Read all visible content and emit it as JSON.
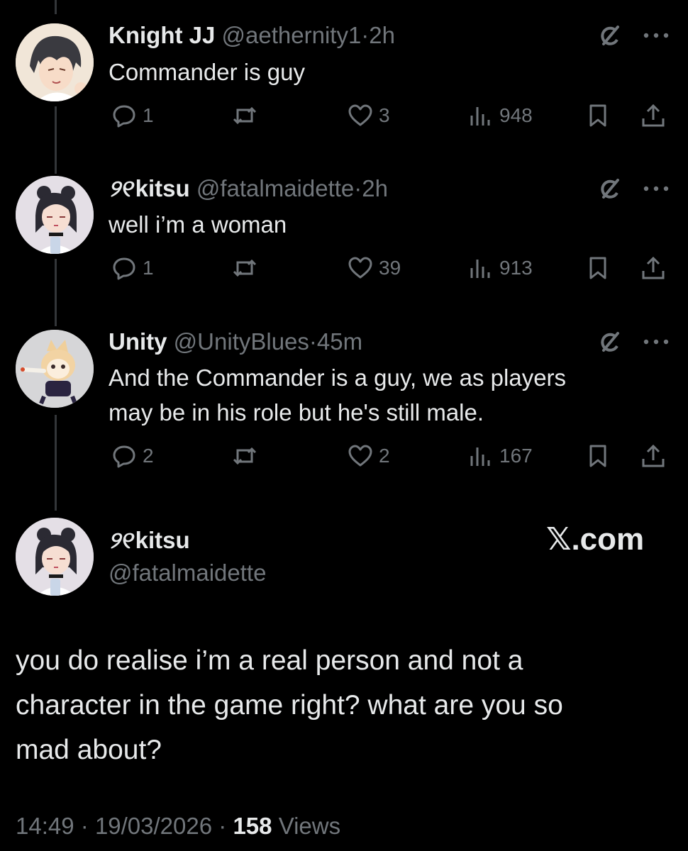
{
  "tweets": [
    {
      "name": "Knight JJ",
      "flower": "",
      "handle": "@aethernity1",
      "time": "2h",
      "text": "Commander is guy",
      "replies": "1",
      "likes": "3",
      "views": "948"
    },
    {
      "name": "kitsu",
      "flower": "୨୧",
      "handle": "@fatalmaidette",
      "time": "2h",
      "text": "well i’m a woman",
      "replies": "1",
      "likes": "39",
      "views": "913"
    },
    {
      "name": "Unity",
      "flower": "",
      "handle": "@UnityBlues",
      "time": "45m",
      "text_line1": "And the Commander is a guy, we as players",
      "text_line2": "may be in his role but he's still male.",
      "replies": "2",
      "likes": "2",
      "views": "167"
    }
  ],
  "main": {
    "flower": "୨୧",
    "name": "kitsu",
    "handle": "@fatalmaidette",
    "brand": "𝕏.com",
    "line1": "you do realise i’m a real person and not a",
    "line2": "character in the game right? what are you so",
    "line3": "mad about?",
    "time": "14:49",
    "date": "19/03/2026",
    "views_count": "158",
    "views_label": "Views"
  },
  "separator": "·",
  "icons": [
    "reply-icon",
    "retweet-icon",
    "like-icon",
    "views-icon",
    "bookmark-icon",
    "share-icon",
    "grok-icon",
    "more-icon"
  ]
}
